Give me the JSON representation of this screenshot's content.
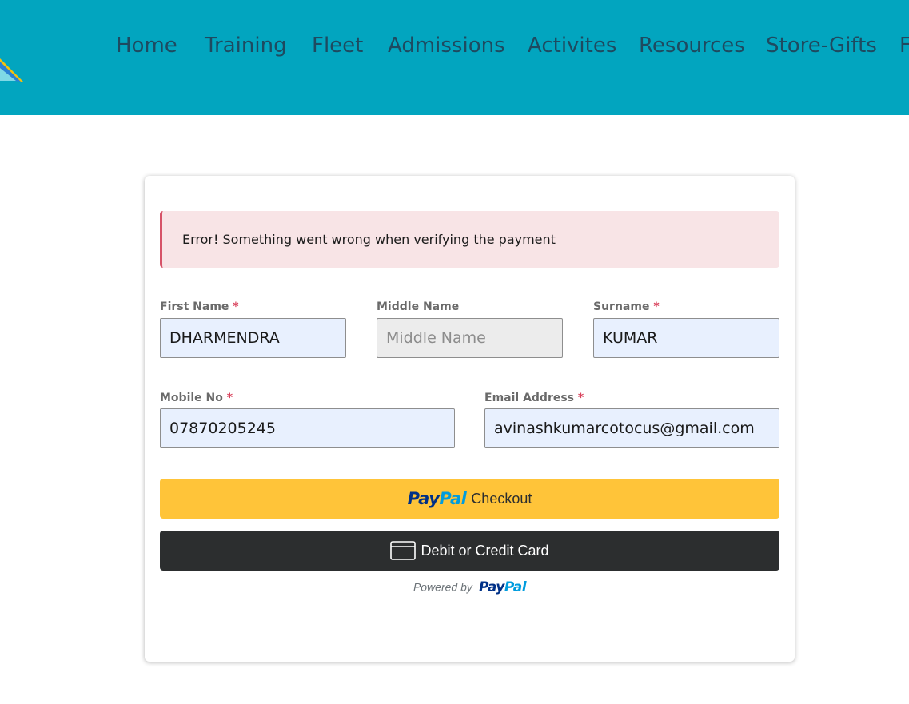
{
  "nav": {
    "items": [
      "Home",
      "Training",
      "Fleet",
      "Admissions",
      "Activites",
      "Resources",
      "Store-Gifts",
      "F"
    ]
  },
  "alert": {
    "text": "Error! Something went wrong when verifying the payment"
  },
  "form": {
    "required_marker": "*",
    "first_name": {
      "label": "First Name",
      "value": "DHARMENDRA"
    },
    "middle_name": {
      "label": "Middle Name",
      "value": "",
      "placeholder": "Middle Name"
    },
    "surname": {
      "label": "Surname",
      "value": "KUMAR"
    },
    "mobile": {
      "label": "Mobile No",
      "value": "07870205245"
    },
    "email": {
      "label": "Email Address",
      "value": "avinashkumarcotocus@gmail.com"
    }
  },
  "paypal_button": {
    "logo_pay": "Pay",
    "logo_pal": "Pal",
    "label": "Checkout"
  },
  "card_button": {
    "icon": "credit-card-icon",
    "label": "Debit or Credit Card"
  },
  "powered_by": {
    "text": "Powered by",
    "logo_pay": "Pay",
    "logo_pal": "Pal"
  },
  "colors": {
    "header_bg": "#02a5bf",
    "nav_text": "#1e4a60",
    "alert_bg": "#f8e4e6",
    "alert_border": "#d65368",
    "required": "#d9435d",
    "paypal_yellow": "#ffc439",
    "paypal_dark_blue": "#003087",
    "paypal_light_blue": "#009cde",
    "card_button_bg": "#2c2e2f",
    "input_autofill_bg": "#e8f0fe"
  }
}
